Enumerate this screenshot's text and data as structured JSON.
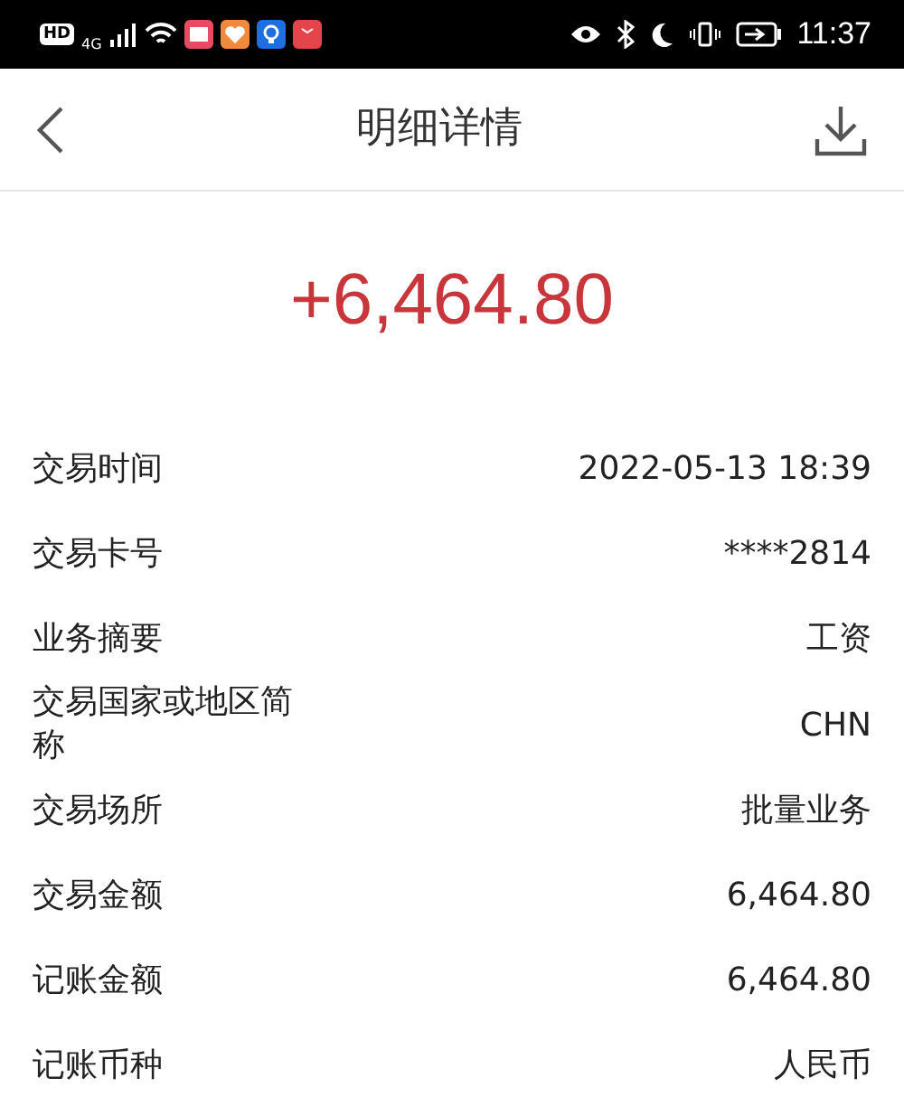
{
  "status_bar": {
    "network_badge": "HD",
    "network_type": "4G",
    "time": "11:37"
  },
  "header": {
    "title": "明细详情"
  },
  "amount": "+6,464.80",
  "details": [
    {
      "label": "交易时间",
      "value": "2022-05-13 18:39"
    },
    {
      "label": "交易卡号",
      "value": "****2814"
    },
    {
      "label": "业务摘要",
      "value": "工资"
    },
    {
      "label": "交易国家或地区简称",
      "value": "CHN"
    },
    {
      "label": "交易场所",
      "value": "批量业务"
    },
    {
      "label": "交易金额",
      "value": "6,464.80"
    },
    {
      "label": "记账金额",
      "value": "6,464.80"
    },
    {
      "label": "记账币种",
      "value": "人民币"
    }
  ]
}
